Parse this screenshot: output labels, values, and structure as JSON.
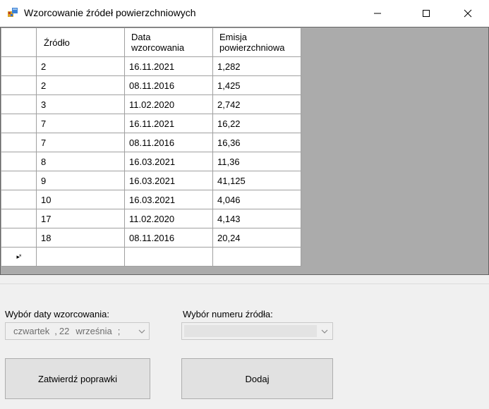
{
  "window": {
    "title": "Wzorcowanie źródeł powierzchniowych",
    "icon": "app-window-icon"
  },
  "grid": {
    "columns": [
      {
        "line1": "Źródło",
        "line2": ""
      },
      {
        "line1": "Data",
        "line2": "wzorcowania"
      },
      {
        "line1": "Emisja",
        "line2": "powierzchniowa"
      }
    ],
    "rows": [
      {
        "zrodlo": "2",
        "data": "16.11.2021",
        "emisja": "1,282"
      },
      {
        "zrodlo": "2",
        "data": "08.11.2016",
        "emisja": "1,425"
      },
      {
        "zrodlo": "3",
        "data": "11.02.2020",
        "emisja": "2,742"
      },
      {
        "zrodlo": "7",
        "data": "16.11.2021",
        "emisja": "16,22"
      },
      {
        "zrodlo": "7",
        "data": "08.11.2016",
        "emisja": "16,36"
      },
      {
        "zrodlo": "8",
        "data": "16.03.2021",
        "emisja": "11,36"
      },
      {
        "zrodlo": "9",
        "data": "16.03.2021",
        "emisja": "41,125"
      },
      {
        "zrodlo": "10",
        "data": "16.03.2021",
        "emisja": "4,046"
      },
      {
        "zrodlo": "17",
        "data": "11.02.2020",
        "emisja": "4,143"
      },
      {
        "zrodlo": "18",
        "data": "08.11.2016",
        "emisja": "20,24"
      }
    ],
    "new_row_marker": "▸*"
  },
  "form": {
    "date_label": "Wybór daty wzorcowania:",
    "date_value": {
      "day_name": "czwartek",
      "separator": ",",
      "day": "22",
      "month": "września",
      "truncated": ";"
    },
    "source_label": "Wybór numeru źródła:",
    "source_value": ""
  },
  "buttons": {
    "confirm_label": "Zatwierdź poprawki",
    "add_label": "Dodaj"
  },
  "colors": {
    "grid_background": "#ababab",
    "window_background": "#f0f0f0",
    "button_background": "#e1e1e1"
  }
}
